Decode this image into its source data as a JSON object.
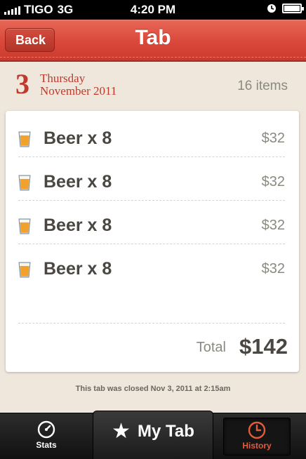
{
  "status_bar": {
    "carrier": "TIGO",
    "network": "3G",
    "time": "4:20 PM"
  },
  "header": {
    "title": "Tab",
    "back_label": "Back"
  },
  "date": {
    "day": "3",
    "weekday": "Thursday",
    "month_year": "November 2011"
  },
  "items_count": "16 items",
  "items": [
    {
      "name": "Beer x 8",
      "price": "$32",
      "icon": "beer-glass-icon"
    },
    {
      "name": "Beer x 8",
      "price": "$32",
      "icon": "beer-glass-icon"
    },
    {
      "name": "Beer x 8",
      "price": "$32",
      "icon": "beer-glass-icon"
    },
    {
      "name": "Beer x 8",
      "price": "$32",
      "icon": "beer-glass-icon"
    }
  ],
  "total": {
    "label": "Total",
    "value": "$142"
  },
  "closed_note": "This tab was closed Nov 3, 2011 at 2:15am",
  "tabbar": {
    "stats_label": "Stats",
    "mytab_label": "My Tab",
    "history_label": "History"
  },
  "colors": {
    "accent_red": "#d9483a",
    "date_red": "#c0392b",
    "history_active": "#e65a3c"
  }
}
